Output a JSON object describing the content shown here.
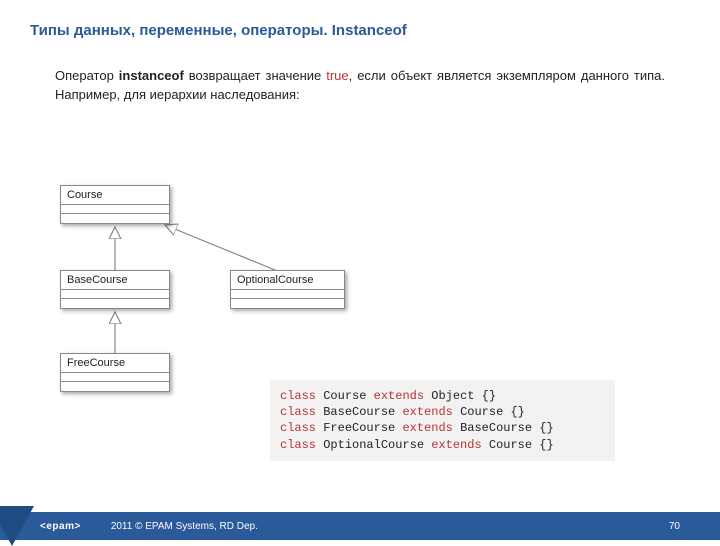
{
  "title": "Типы данных, переменные, операторы. Instanceof",
  "paragraph": {
    "pre": "Оператор ",
    "kw": "instanceof",
    "mid": " возвращает значение ",
    "true": "true",
    "post": ", если объект является экземпляром данного типа. Например, для иерархии наследования:"
  },
  "uml": {
    "course": "Course",
    "base": "BaseCourse",
    "free": "FreeCourse",
    "optional": "OptionalCourse"
  },
  "code": {
    "class_kw": "class",
    "extends_kw": "extends",
    "l1_name": "Course",
    "l1_parent": "Object",
    "l2_name": "BaseCourse",
    "l2_parent": "Course",
    "l3_name": "FreeCourse",
    "l3_parent": "BaseCourse",
    "l4_name": "OptionalCourse",
    "l4_parent": "Course",
    "braces": " {}"
  },
  "footer": {
    "logo": "<epam>",
    "copyright": "2011 © EPAM Systems, RD Dep.",
    "page": "70"
  }
}
